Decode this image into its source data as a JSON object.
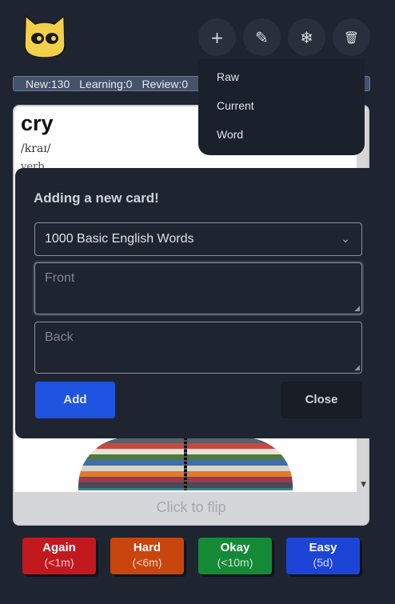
{
  "toolbar": {
    "icons": [
      "plus-icon",
      "pencil-icon",
      "snowflake-icon",
      "trash-icon"
    ],
    "add": "+",
    "edit": "✎",
    "freeze": "❄",
    "delete": "🗑"
  },
  "stats": {
    "new": "New:130",
    "learning": "Learning:0",
    "review": "Review:0"
  },
  "menu": {
    "items": [
      "Raw",
      "Current",
      "Word"
    ]
  },
  "card": {
    "word": "cry",
    "phonetic": "/kraɪ/",
    "part_of_speech": "verb",
    "flip_label": "Click to flip"
  },
  "modal": {
    "title": "Adding a new card!",
    "deck": "1000 Basic English Words",
    "front_placeholder": "Front",
    "back_placeholder": "Back",
    "add_label": "Add",
    "close_label": "Close"
  },
  "answers": [
    {
      "label": "Again",
      "interval": "(<1m)",
      "color": "#c2191f"
    },
    {
      "label": "Hard",
      "interval": "(<6m)",
      "color": "#c8460e"
    },
    {
      "label": "Okay",
      "interval": "(<10m)",
      "color": "#148a36"
    },
    {
      "label": "Easy",
      "interval": "(5d)",
      "color": "#1c45d8"
    }
  ],
  "colors": {
    "background": "#1e2430",
    "accent": "#1f54e0",
    "logo": "#f2d04a"
  }
}
